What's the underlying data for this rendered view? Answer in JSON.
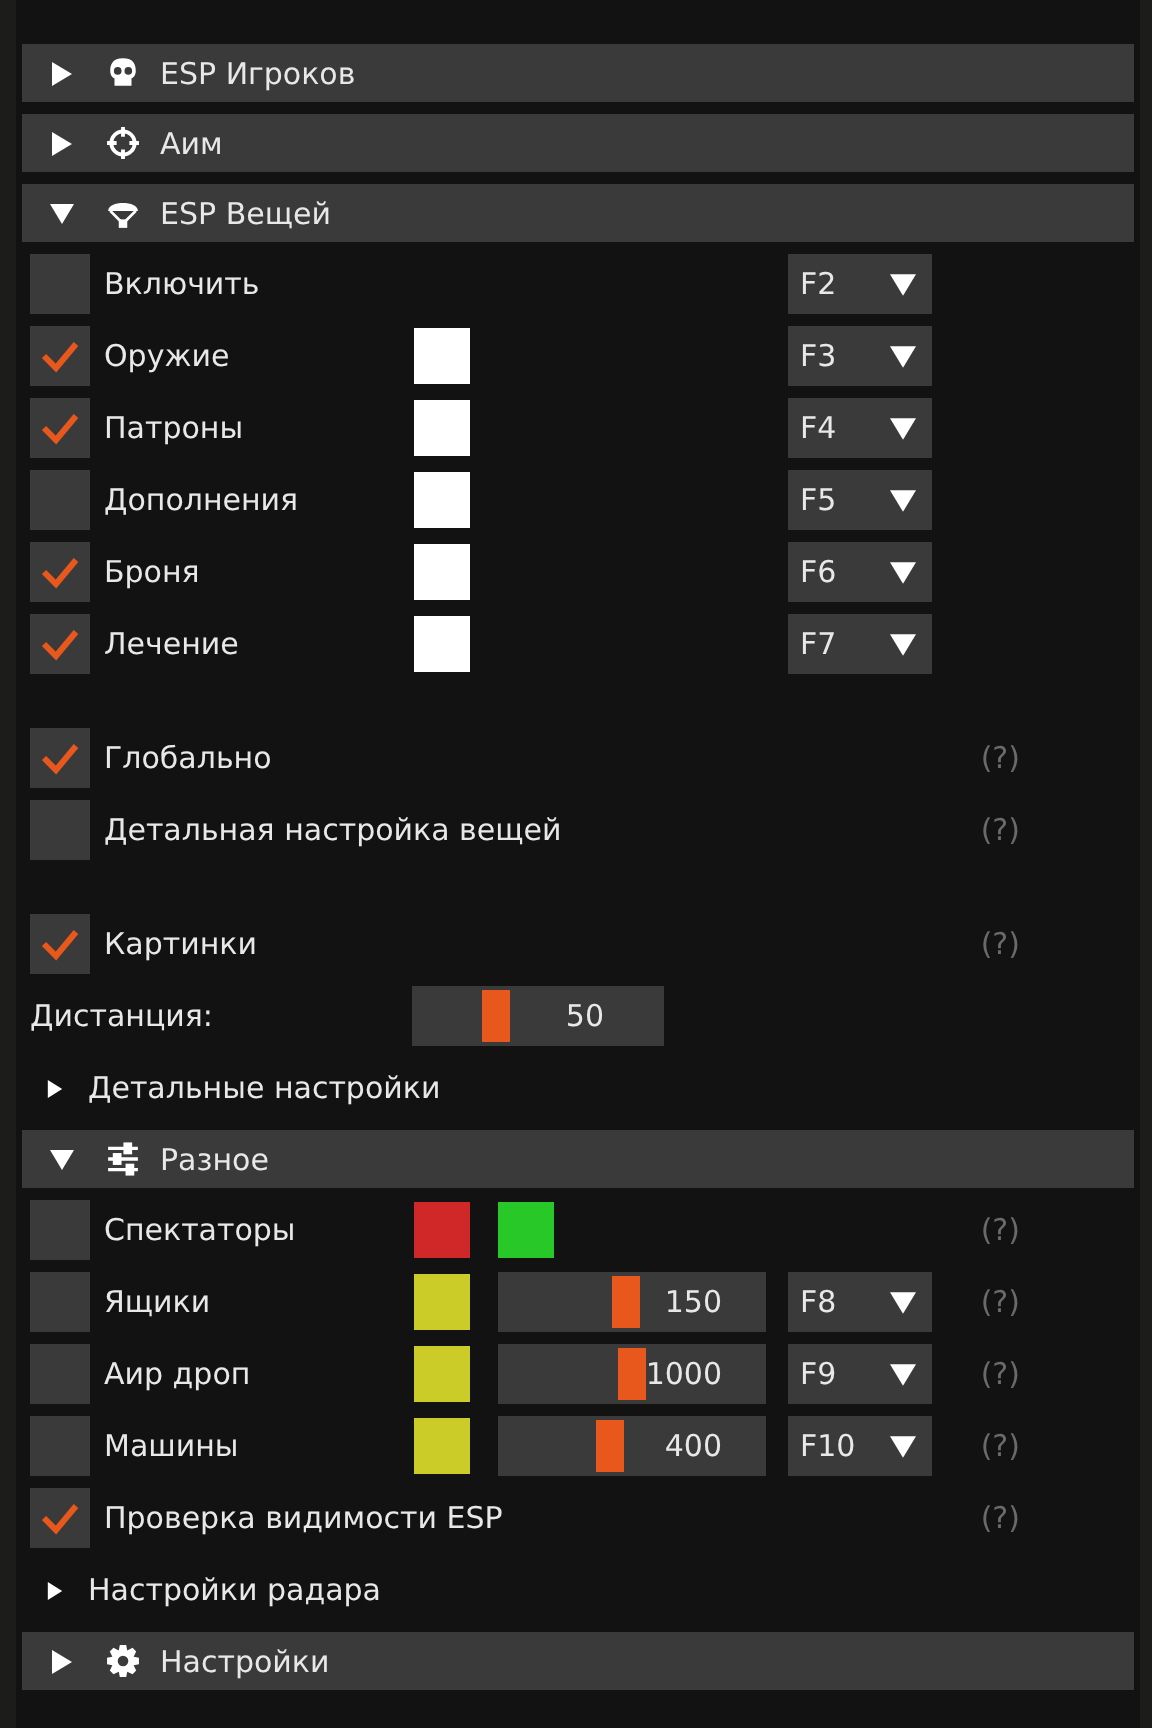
{
  "sections": [
    {
      "title": "ESP Игроков",
      "expanded": false
    },
    {
      "title": "Аим",
      "expanded": false
    },
    {
      "title": "ESP Вещей",
      "expanded": true,
      "groups": [
        [
          {
            "kind": "check",
            "label": "Включить",
            "checked": false,
            "hotkey": "F2"
          },
          {
            "kind": "check",
            "label": "Оружие",
            "checked": true,
            "swatches": [
              {
                "color": "#ffffff"
              }
            ],
            "hotkey": "F3"
          },
          {
            "kind": "check",
            "label": "Патроны",
            "checked": true,
            "swatches": [
              {
                "color": "#ffffff"
              }
            ],
            "hotkey": "F4"
          },
          {
            "kind": "check",
            "label": "Дополнения",
            "checked": false,
            "swatches": [
              {
                "color": "#ffffff"
              }
            ],
            "hotkey": "F5"
          },
          {
            "kind": "check",
            "label": "Броня",
            "checked": true,
            "swatches": [
              {
                "color": "#ffffff"
              }
            ],
            "hotkey": "F6"
          },
          {
            "kind": "check",
            "label": "Лечение",
            "checked": true,
            "swatches": [
              {
                "color": "#ffffff"
              }
            ],
            "hotkey": "F7"
          }
        ],
        [
          {
            "kind": "check",
            "label": "Глобально",
            "checked": true,
            "help": "(?)"
          },
          {
            "kind": "check",
            "label": "Детальная настройка вещей",
            "checked": false,
            "help": "(?)"
          }
        ],
        [
          {
            "kind": "check",
            "label": "Картинки",
            "checked": true,
            "help": "(?)"
          },
          {
            "kind": "slider",
            "label": "Дистанция:",
            "value": "50",
            "level": 0.33
          },
          {
            "kind": "tree",
            "label": "Детальные настройки",
            "expanded": false
          }
        ]
      ]
    },
    {
      "title": "Разное",
      "expanded": true,
      "groups": [
        [
          {
            "kind": "check",
            "label": "Спектаторы",
            "checked": false,
            "swatches": [
              {
                "color": "#d02828"
              },
              {
                "color": "#28c828"
              }
            ],
            "help": "(?)"
          },
          {
            "kind": "check",
            "label": "Ящики",
            "checked": false,
            "swatches": [
              {
                "color": "#cccc28"
              }
            ],
            "slider": {
              "value": "150",
              "level": 0.48
            },
            "hotkey": "F8",
            "help": "(?)"
          },
          {
            "kind": "check",
            "label": "Аир дроп",
            "checked": false,
            "swatches": [
              {
                "color": "#cccc28"
              }
            ],
            "slider": {
              "value": "1000",
              "level": 0.5
            },
            "hotkey": "F9",
            "help": "(?)"
          },
          {
            "kind": "check",
            "label": "Машины",
            "checked": false,
            "swatches": [
              {
                "color": "#cccc28"
              }
            ],
            "slider": {
              "value": "400",
              "level": 0.42
            },
            "hotkey": "F10",
            "help": "(?)"
          },
          {
            "kind": "check",
            "label": "Проверка видимости ESP",
            "checked": true,
            "help": "(?)"
          },
          {
            "kind": "tree",
            "label": "Настройки радара",
            "expanded": false
          }
        ]
      ]
    },
    {
      "title": "Настройки",
      "expanded": false
    }
  ]
}
